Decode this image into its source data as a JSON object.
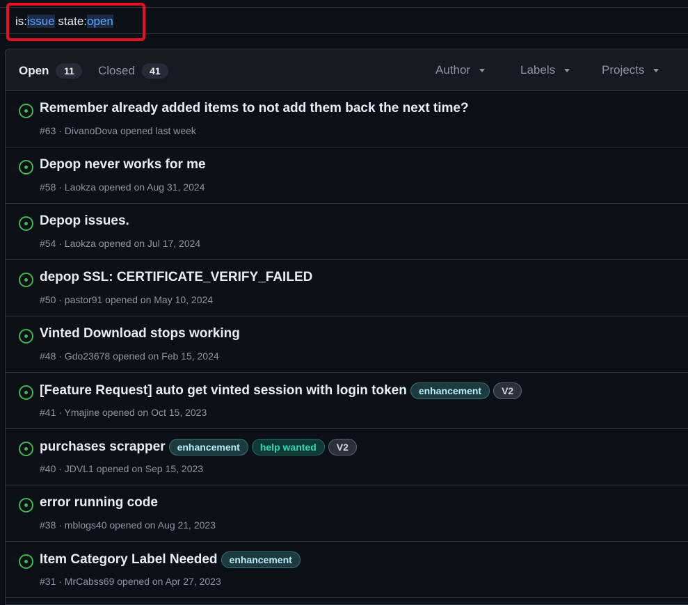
{
  "search": {
    "prefix1": "is:",
    "value1": "issue",
    "space": " ",
    "prefix2": "state:",
    "value2": "open"
  },
  "header": {
    "open_label": "Open",
    "open_count": "11",
    "closed_label": "Closed",
    "closed_count": "41",
    "filters": [
      "Author",
      "Labels",
      "Projects"
    ]
  },
  "issues": [
    {
      "title": "Remember already added items to not add them back the next time?",
      "meta": "#63 · DivanoDova opened last week",
      "labels": []
    },
    {
      "title": "Depop never works for me",
      "meta": "#58 · Laokza opened on Aug 31, 2024",
      "labels": []
    },
    {
      "title": "Depop issues.",
      "meta": "#54 · Laokza opened on Jul 17, 2024",
      "labels": []
    },
    {
      "title": "depop SSL: CERTIFICATE_VERIFY_FAILED",
      "meta": "#50 · pastor91 opened on May 10, 2024",
      "labels": []
    },
    {
      "title": "Vinted Download stops working",
      "meta": "#48 · Gdo23678 opened on Feb 15, 2024",
      "labels": []
    },
    {
      "title": "[Feature Request] auto get vinted session with login token",
      "meta": "#41 · Ymajine opened on Oct 15, 2023",
      "labels": [
        "enhancement",
        "V2"
      ]
    },
    {
      "title": "purchases scrapper",
      "meta": "#40 · JDVL1 opened on Sep 15, 2023",
      "labels": [
        "enhancement",
        "help wanted",
        "V2"
      ]
    },
    {
      "title": "error running code",
      "meta": "#38 · mblogs40 opened on Aug 21, 2023",
      "labels": []
    },
    {
      "title": "Item Category Label Needed",
      "meta": "#31 · MrCabss69 opened on Apr 27, 2023",
      "labels": [
        "enhancement"
      ]
    }
  ],
  "colors": {
    "open_icon": "#3fb950",
    "highlight": "#e81123"
  }
}
